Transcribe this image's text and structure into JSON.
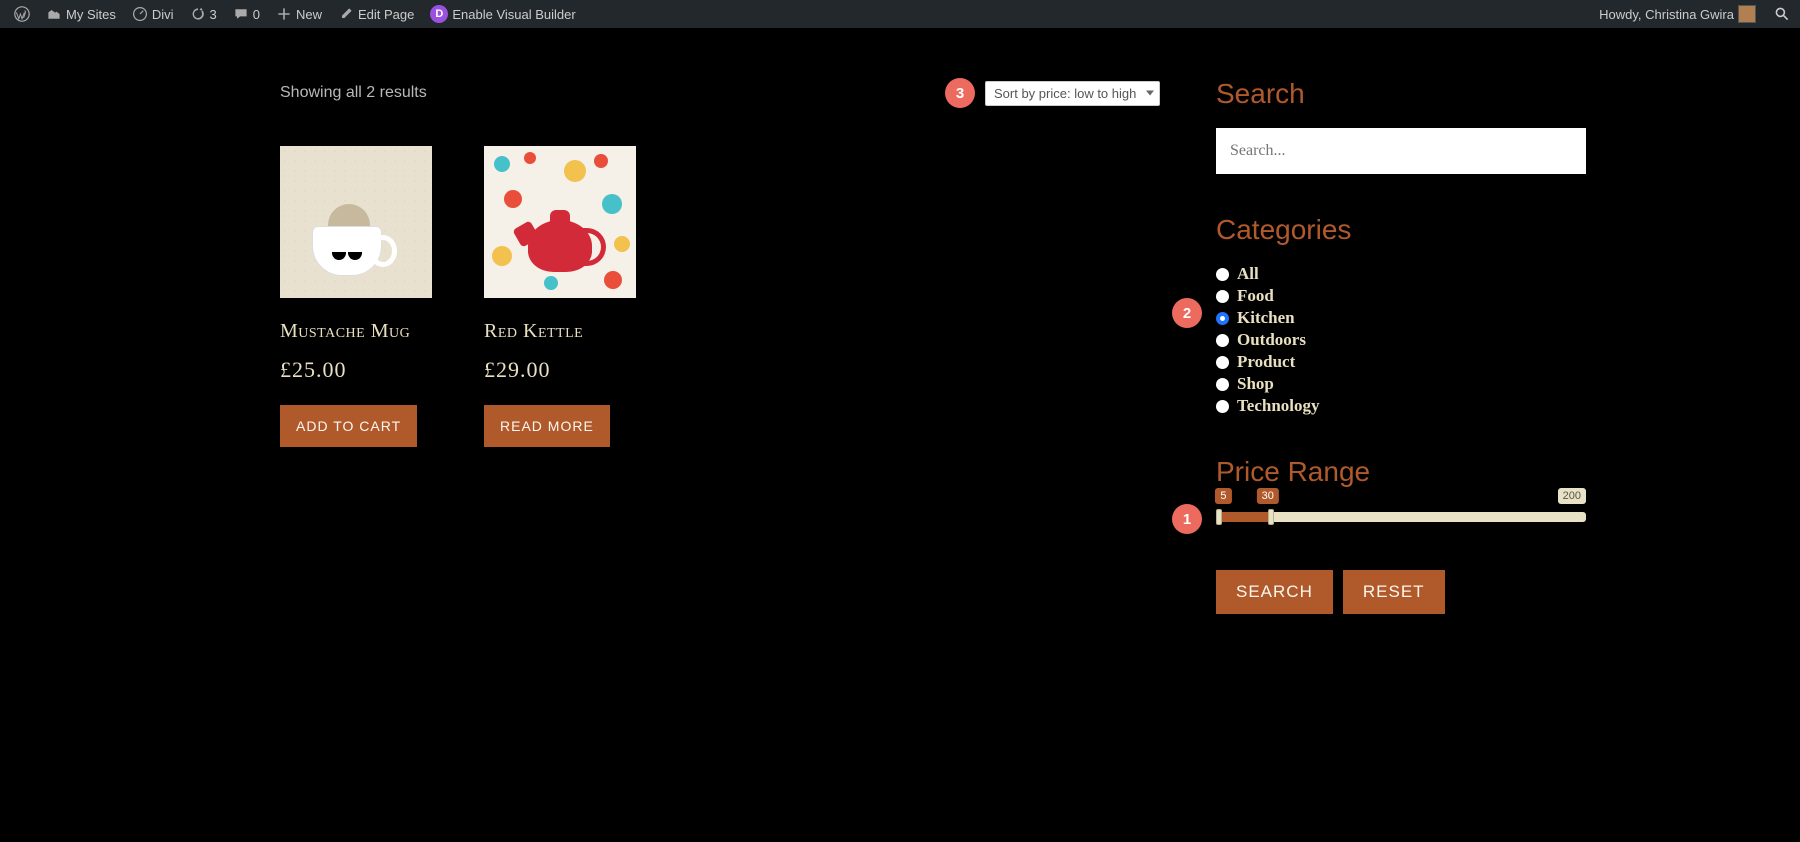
{
  "adminbar": {
    "my_sites": "My Sites",
    "site": "Divi",
    "updates": "3",
    "comments": "0",
    "new": "New",
    "edit_page": "Edit Page",
    "visual_builder": "Enable Visual Builder",
    "howdy": "Howdy, Christina Gwira"
  },
  "main": {
    "result_count": "Showing all 2 results",
    "sort_value": "Sort by price: low to high",
    "products": [
      {
        "title": "Mustache Mug",
        "price": "£25.00",
        "button": "ADD TO CART"
      },
      {
        "title": "Red Kettle",
        "price": "£29.00",
        "button": "READ MORE"
      }
    ]
  },
  "sidebar": {
    "search": {
      "title": "Search",
      "placeholder": "Search..."
    },
    "categories": {
      "title": "Categories",
      "items": [
        {
          "label": "All",
          "checked": false
        },
        {
          "label": "Food",
          "checked": false
        },
        {
          "label": "Kitchen",
          "checked": true
        },
        {
          "label": "Outdoors",
          "checked": false
        },
        {
          "label": "Product",
          "checked": false
        },
        {
          "label": "Shop",
          "checked": false
        },
        {
          "label": "Technology",
          "checked": false
        }
      ]
    },
    "price": {
      "title": "Price Range",
      "min": "5",
      "current": "30",
      "max": "200"
    },
    "buttons": {
      "search": "SEARCH",
      "reset": "RESET"
    }
  },
  "annotations": {
    "a1": "1",
    "a2": "2",
    "a3": "3"
  }
}
